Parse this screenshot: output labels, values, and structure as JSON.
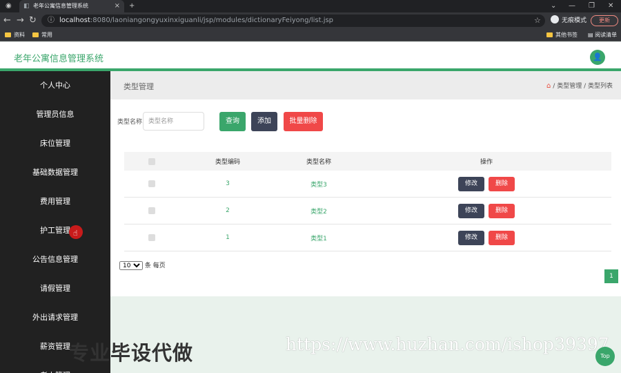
{
  "browser": {
    "tab_title": "老年公寓信息管理系统",
    "url_host": "localhost",
    "url_rest": ":8080/laoniangongyuxinxiguanli/jsp/modules/dictionaryFeiyong/list.jsp",
    "incognito_label": "无痕模式",
    "update_label": "更新",
    "bookmarks": [
      "资料",
      "常用"
    ],
    "bookmark_right": [
      "其他书签",
      "阅读清单"
    ]
  },
  "app": {
    "title": "老年公寓信息管理系统",
    "brand_color": "#3aa66b"
  },
  "sidebar": {
    "items": [
      "个人中心",
      "管理员信息",
      "床位管理",
      "基础数据管理",
      "费用管理",
      "护工管理",
      "公告信息管理",
      "请假管理",
      "外出请求管理",
      "薪资管理",
      "老人管理"
    ]
  },
  "page": {
    "title": "类型管理",
    "breadcrumb": [
      "类型管理",
      "类型列表"
    ]
  },
  "search": {
    "label": "类型名称",
    "placeholder": "类型名称",
    "query_label": "查询",
    "add_label": "添加",
    "batch_delete_label": "批量删除"
  },
  "table": {
    "headers": [
      "类型编码",
      "类型名称",
      "操作"
    ],
    "rows": [
      {
        "code": "3",
        "name": "类型3"
      },
      {
        "code": "2",
        "name": "类型2"
      },
      {
        "code": "1",
        "name": "类型1"
      }
    ],
    "edit_label": "修改",
    "delete_label": "删除"
  },
  "pagination": {
    "page_size": "10",
    "page_size_suffix": "条 每页",
    "current_page": "1"
  },
  "watermark": {
    "cn": "专业毕设代做",
    "url": "https://www.huzhan.com/ishop39397"
  },
  "top_label": "Top"
}
